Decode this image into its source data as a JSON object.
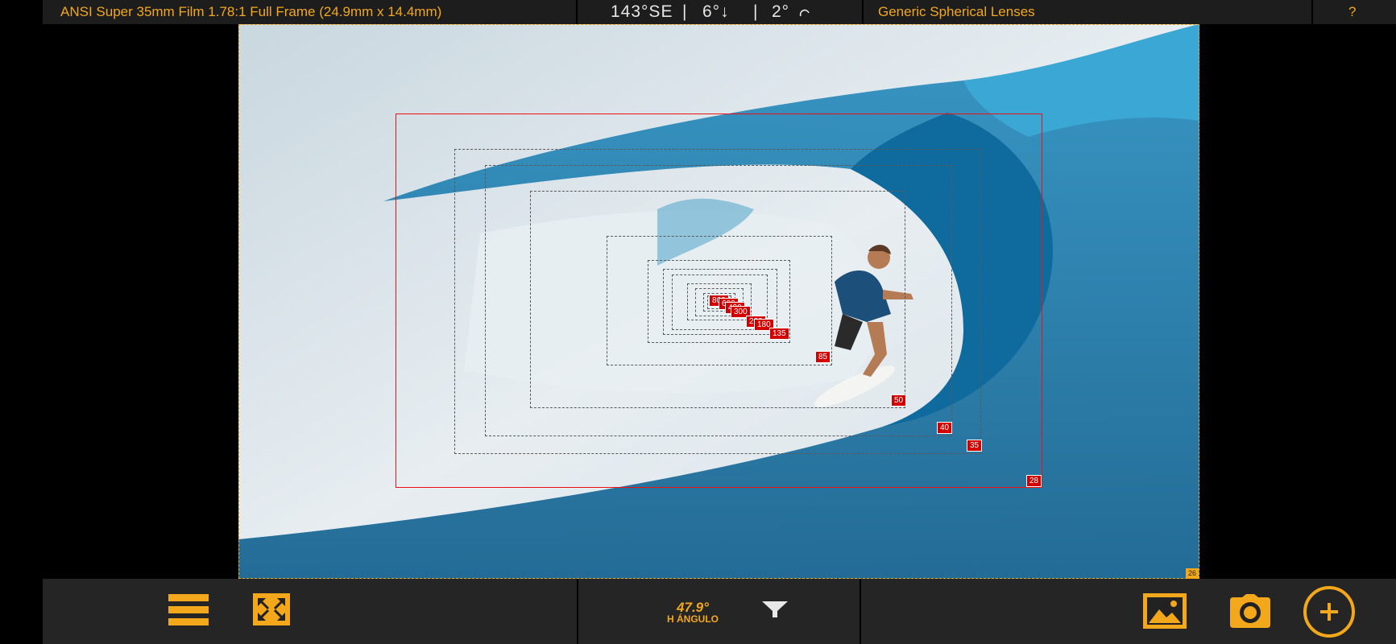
{
  "topbar": {
    "format": "ANSI Super 35mm Film 1.78:1 Full Frame (24.9mm x 14.4mm)",
    "heading": "143°SE",
    "tilt": "6°↓",
    "roll": "2°",
    "lens": "Generic Spherical Lenses",
    "help": "?"
  },
  "viewer": {
    "outer_label": "26",
    "focal_labels": [
      "800",
      "600",
      "400",
      "300",
      "200",
      "180",
      "135",
      "85",
      "50",
      "40",
      "35",
      "28"
    ]
  },
  "bottombar": {
    "angle_value": "47.9°",
    "angle_label": "H ÁNGULO"
  },
  "colors": {
    "accent": "#f3a81b",
    "frame_red": "#e11111",
    "bar": "#252525"
  },
  "icons": [
    "menu-icon",
    "fullscreen-icon",
    "filter-icon",
    "gallery-icon",
    "camera-icon",
    "add-icon"
  ]
}
